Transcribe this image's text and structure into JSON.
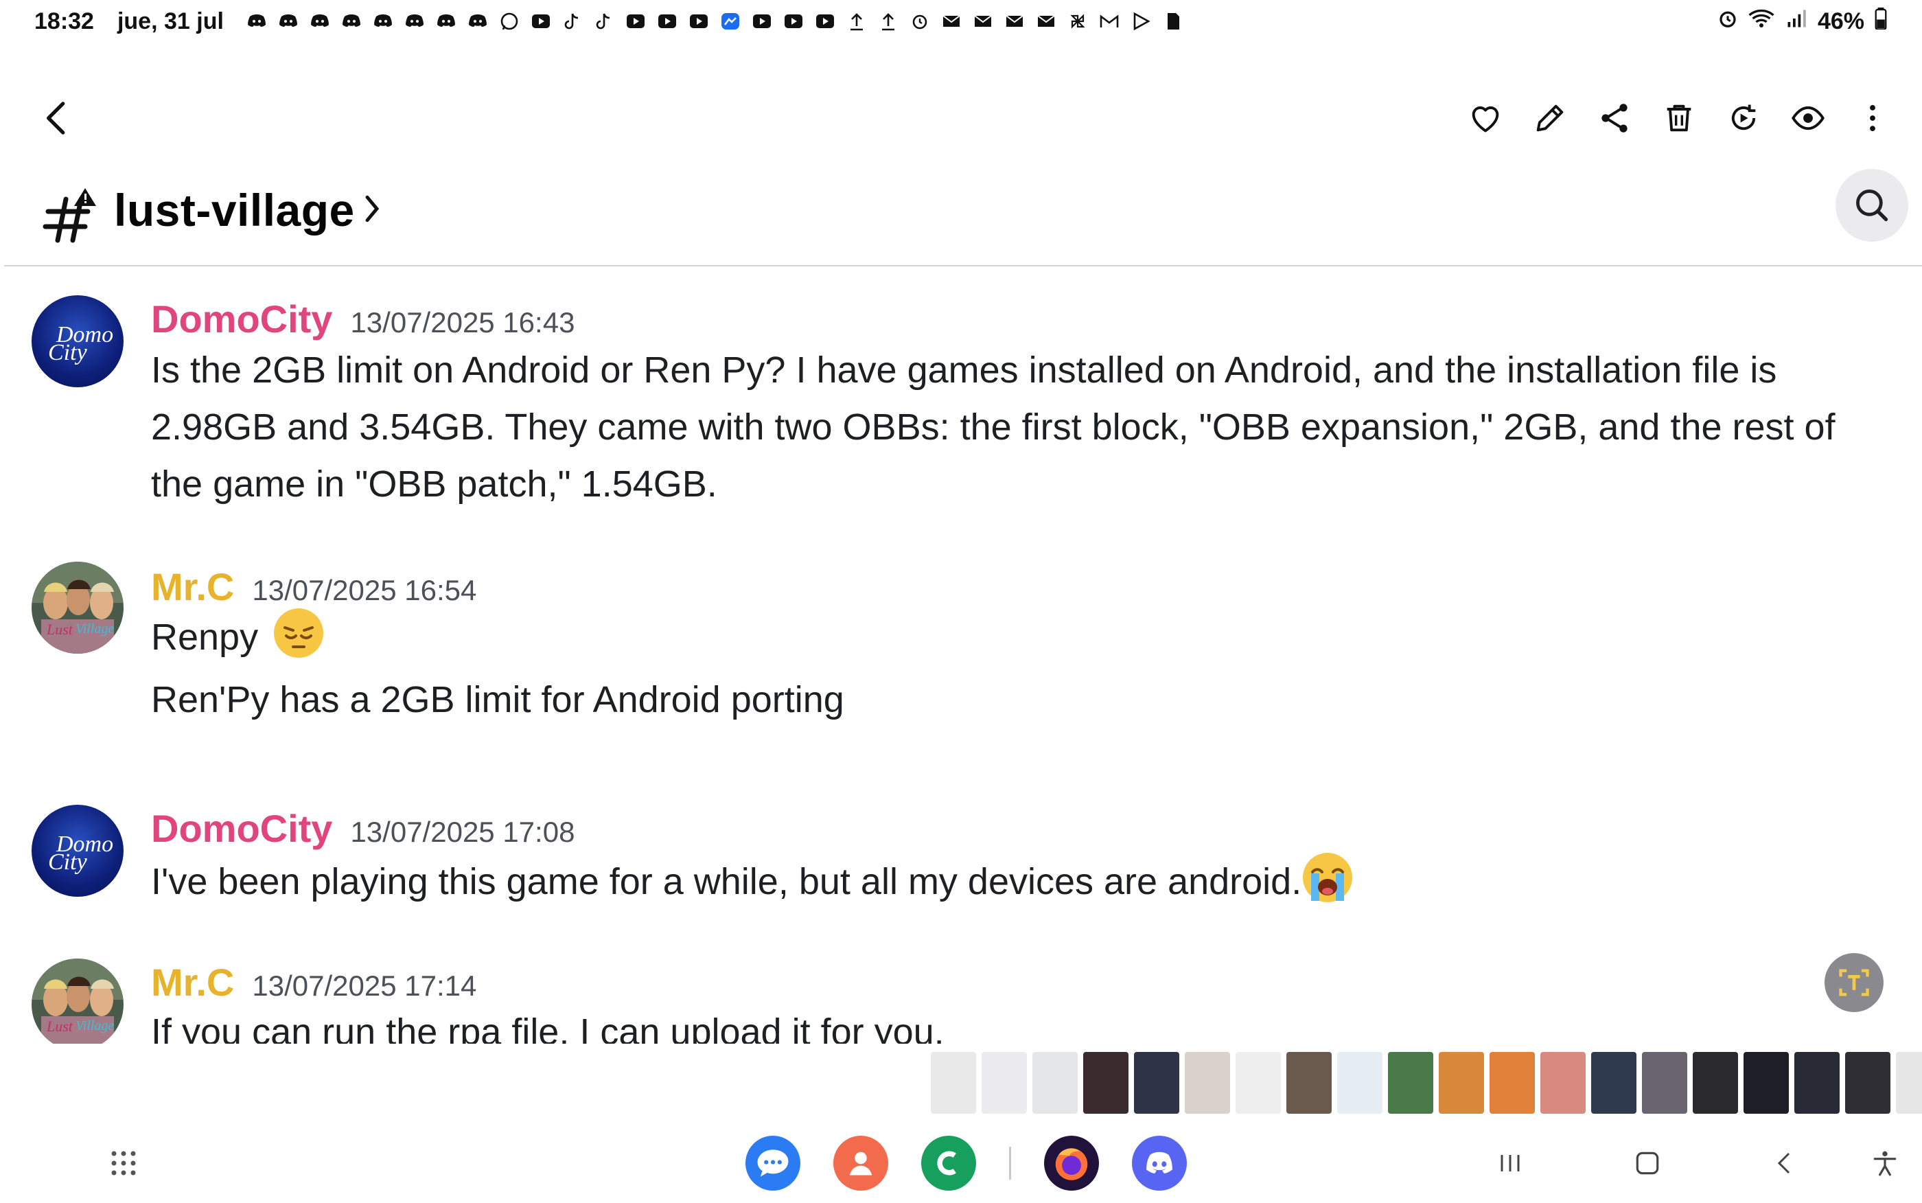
{
  "status_bar": {
    "time": "18:32",
    "date": "jue, 31 jul",
    "battery": "46%",
    "notification_icons": [
      "discord-icon",
      "discord-icon",
      "discord-icon",
      "discord-icon",
      "discord-icon",
      "discord-icon",
      "discord-icon",
      "discord-icon",
      "whatsapp-icon",
      "youtube-icon",
      "tiktok-icon",
      "tiktok-icon",
      "youtube-icon",
      "youtube-icon",
      "youtube-icon",
      "messenger-icon",
      "youtube-icon",
      "youtube-icon",
      "youtube-icon",
      "upload-icon",
      "upload-icon",
      "alarm-icon",
      "mail-icon",
      "mail-icon",
      "mail-icon",
      "mail-icon",
      "pinwheel-icon",
      "gmail-icon",
      "play-store-icon",
      "sd-card-icon"
    ]
  },
  "viewer_toolbar": {
    "actions": [
      "favorite",
      "edit",
      "share",
      "delete",
      "remaster",
      "view",
      "more-options"
    ]
  },
  "channel": {
    "name": "lust-village"
  },
  "messages": [
    {
      "author": "DomoCity",
      "timestamp": "13/07/2025 16:43",
      "avatar_text": "Domo City",
      "lines": [
        "Is the 2GB limit on Android or Ren Py? I have games installed on Android, and the installation file is",
        "2.98GB and 3.54GB. They came with two OBBs: the first block, \"OBB expansion,\" 2GB, and the rest of",
        "the game in \"OBB patch,\" 1.54GB."
      ]
    },
    {
      "author": "Mr.C",
      "timestamp": "13/07/2025 16:54",
      "lines": [
        "Renpy",
        "Ren'Py has a 2GB limit for Android porting"
      ],
      "emoji": "pensive-face"
    },
    {
      "author": "DomoCity",
      "timestamp": "13/07/2025 17:08",
      "avatar_text": "Domo City",
      "lines": [
        "I've been playing this game for a while, but all my devices are android."
      ],
      "emoji": "loudly-crying-face"
    },
    {
      "author": "Mr.C",
      "timestamp": "13/07/2025 17:14",
      "lines": [
        "If you can run the rpa file, I can upload it for you."
      ]
    }
  ],
  "colors": {
    "author_domocity": "#e0457b",
    "author_mrc": "#e8b32c",
    "text": "#1e1f22",
    "timestamp": "#4e5058"
  },
  "dock": [
    "messages-app",
    "contacts-app",
    "phone-app",
    "firefox-app",
    "discord-app"
  ],
  "nav_buttons": [
    "recent-apps",
    "home",
    "back",
    "accessibility"
  ]
}
